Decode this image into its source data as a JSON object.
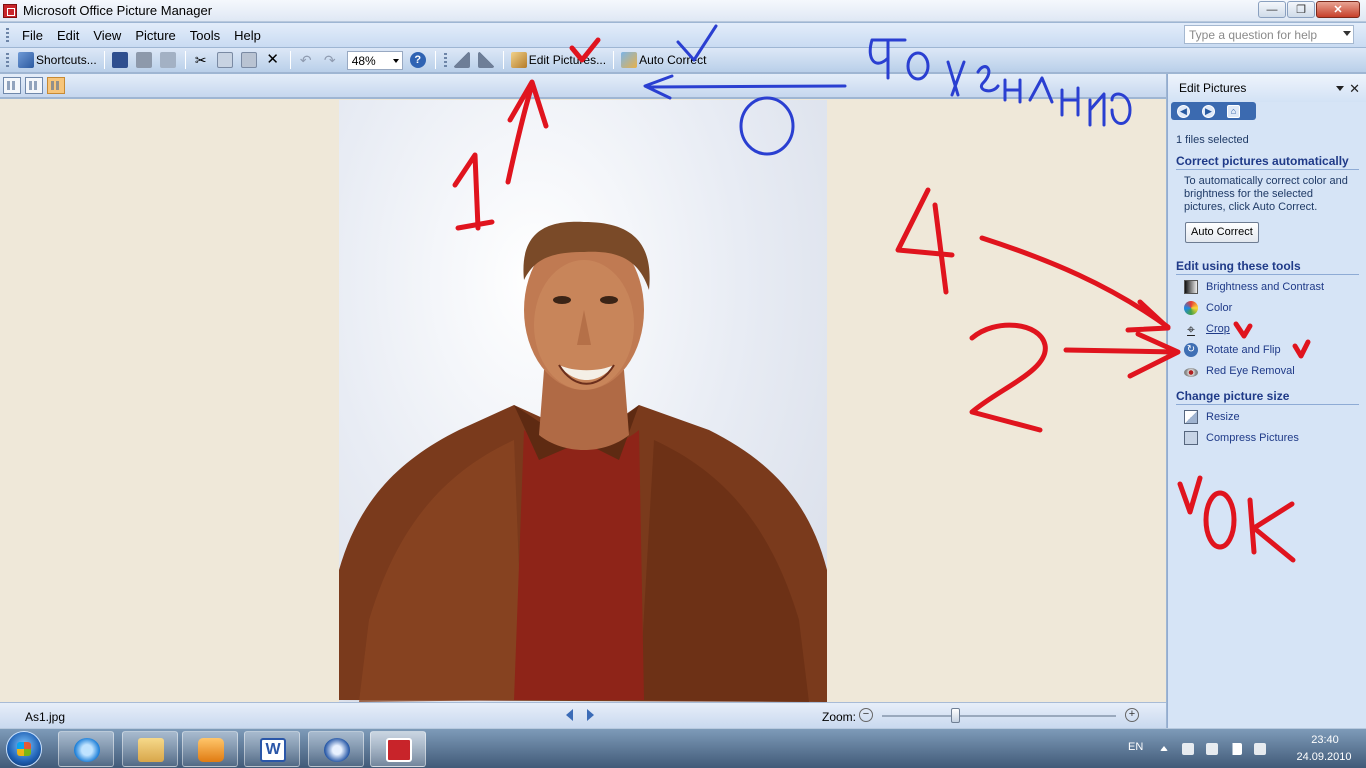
{
  "window": {
    "title": "Microsoft Office Picture Manager",
    "controls": [
      "minimize",
      "maximize",
      "close"
    ]
  },
  "menu": {
    "items": [
      {
        "label": "File",
        "icon": "menu"
      },
      {
        "label": "Edit",
        "icon": "menu"
      },
      {
        "label": "View",
        "icon": "menu"
      },
      {
        "label": "Picture",
        "icon": "menu"
      },
      {
        "label": "Tools",
        "icon": "menu"
      },
      {
        "label": "Help",
        "icon": "menu"
      }
    ],
    "help_placeholder": "Type a question for help"
  },
  "toolbar": {
    "shortcuts_label": "Shortcuts...",
    "zoom_value": "48%",
    "edit_pictures_label": "Edit Pictures...",
    "auto_correct_label": "Auto Correct"
  },
  "status": {
    "file_name": "As1.jpg",
    "zoom_label": "Zoom:",
    "zoom_level": 0.31
  },
  "taskpane": {
    "title": "Edit Pictures",
    "selected": "1 files selected",
    "section_auto": "Correct pictures automatically",
    "auto_desc": "To automatically correct color and brightness for the selected pictures, click Auto Correct.",
    "auto_button": "Auto Correct",
    "section_tools": "Edit using these tools",
    "tools": [
      {
        "label": "Brightness and Contrast",
        "icon": "brightness-icon"
      },
      {
        "label": "Color",
        "icon": "color-icon"
      },
      {
        "label": "Crop",
        "icon": "crop-icon"
      },
      {
        "label": "Rotate and Flip",
        "icon": "rotate-icon"
      },
      {
        "label": "Red Eye Removal",
        "icon": "eye-icon"
      }
    ],
    "section_size": "Change picture size",
    "size_tools": [
      {
        "label": "Resize",
        "icon": "resize-icon"
      },
      {
        "label": "Compress Pictures",
        "icon": "compress-icon"
      }
    ]
  },
  "taskbar": {
    "language": "EN",
    "time": "23:40",
    "date": "24.09.2010"
  },
  "colors": {
    "annotation_red": "#e0141e",
    "annotation_blue": "#2a3fd1",
    "taskpane_link": "#1f3a88"
  }
}
